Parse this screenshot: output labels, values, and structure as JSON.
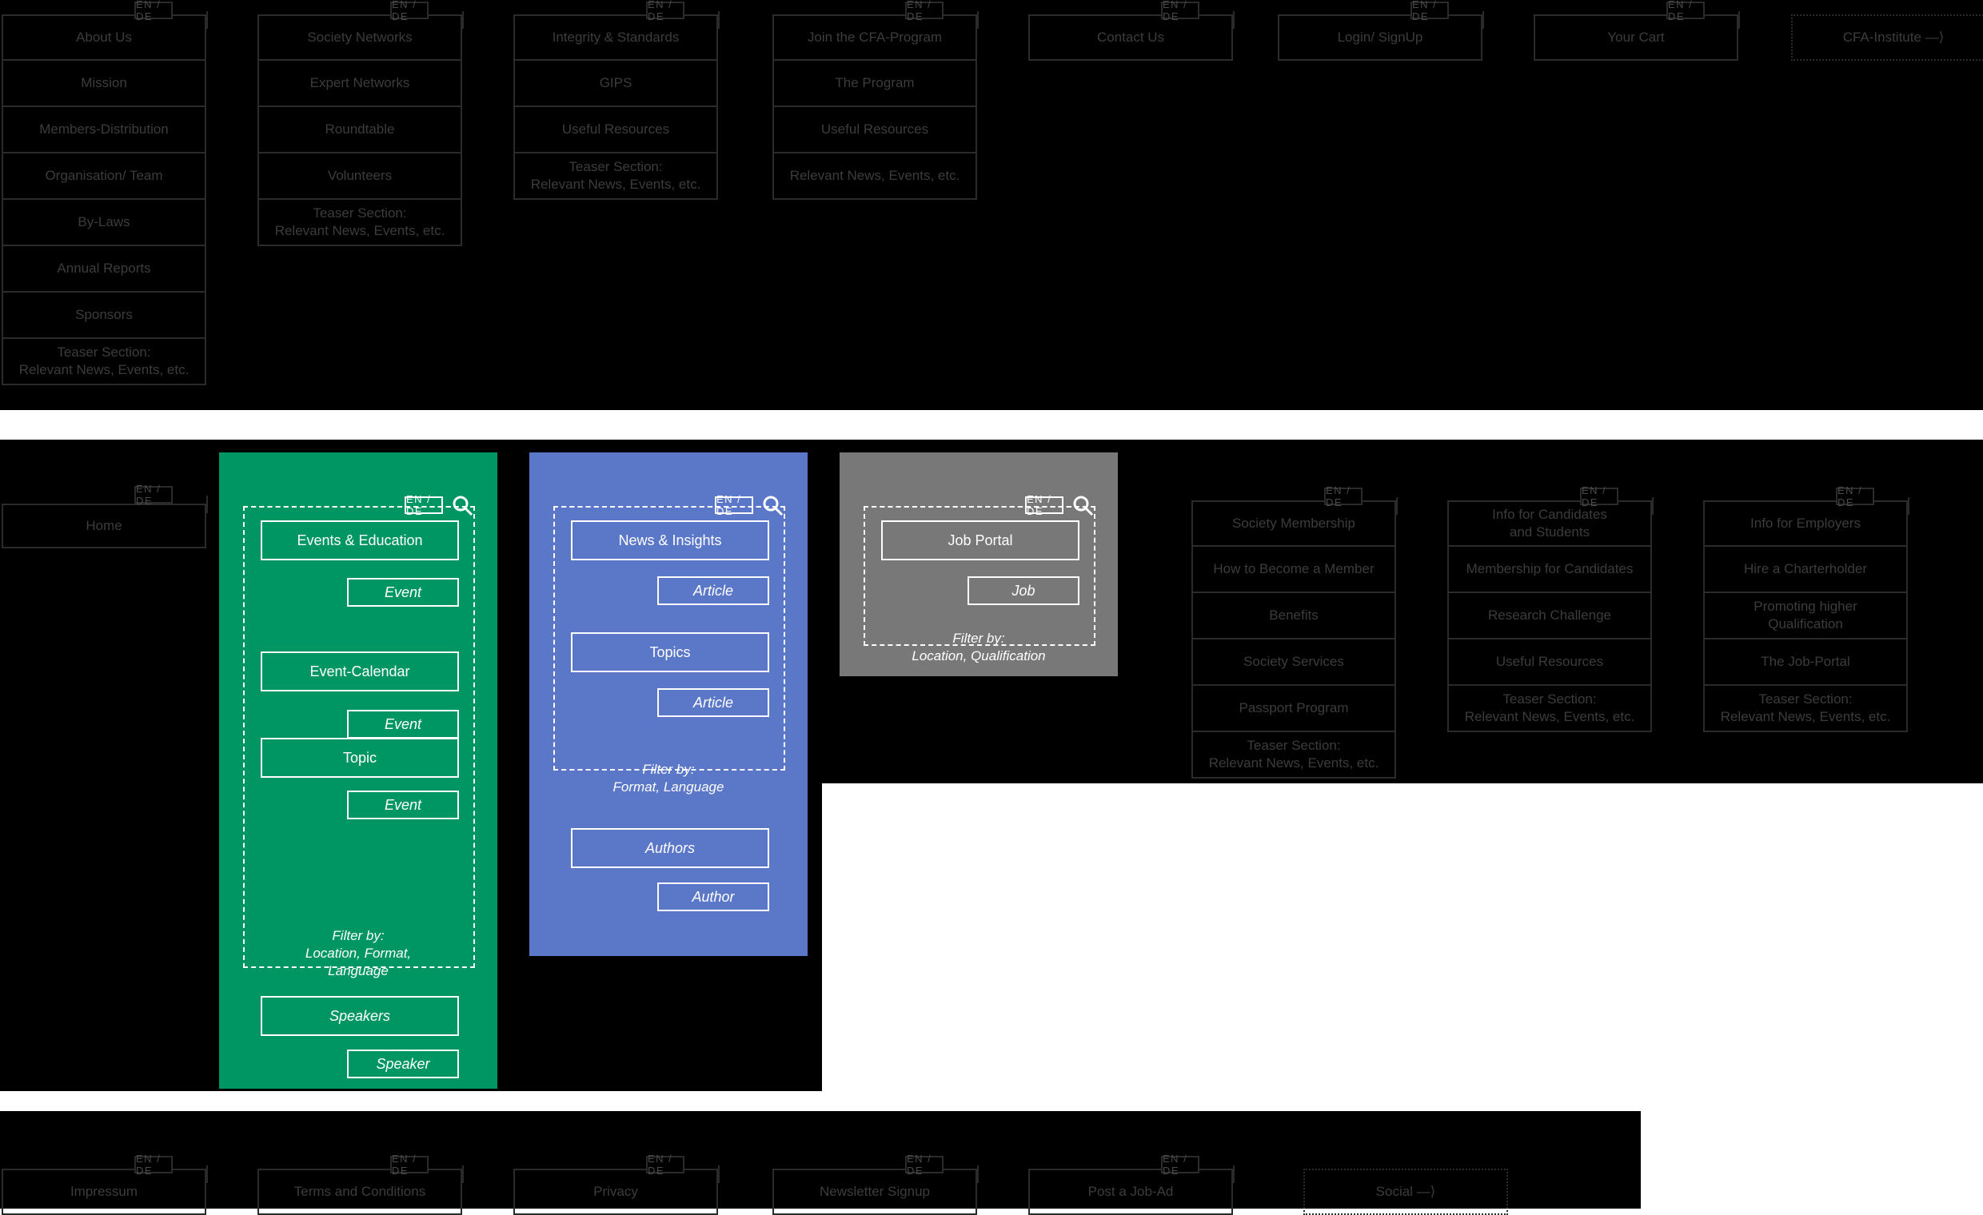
{
  "meta": {
    "lang_chip": "EN / DE",
    "colors": {
      "green": "#009663",
      "blue": "#5B77C8",
      "grey": "#787878",
      "panel_black": "#000000",
      "node_border": "#2b2b2b",
      "node_text": "#3c3c3c",
      "light_text": "#ffffff"
    },
    "teaser_line1": "Teaser Section:",
    "teaser_line2": "Relevant News, Events, etc."
  },
  "top_nav": {
    "columns": [
      {
        "header": "About Us",
        "items": [
          "Mission",
          "Members-Distribution",
          "Organisation/ Team",
          "By-Laws",
          "Annual Reports",
          "Sponsors",
          "Teaser Section:\nRelevant News, Events, etc."
        ]
      },
      {
        "header": "Society Networks",
        "items": [
          "Expert Networks",
          "Roundtable",
          "Volunteers",
          "Teaser Section:\nRelevant News, Events, etc."
        ]
      },
      {
        "header": "Integrity & Standards",
        "items": [
          "GIPS",
          "Useful Resources",
          "Teaser Section:\nRelevant News, Events, etc."
        ]
      },
      {
        "header": "Join the CFA-Program",
        "items": [
          "The Program",
          "Useful Resources",
          "Relevant News, Events, etc."
        ]
      }
    ],
    "standalone": [
      {
        "label": "Contact Us",
        "external": false
      },
      {
        "label": "Login/ SignUp",
        "external": false
      },
      {
        "label": "Your Cart",
        "external": false
      },
      {
        "label": "CFA-Institute —⟩",
        "external": true
      }
    ]
  },
  "home": {
    "label": "Home"
  },
  "sections": [
    {
      "key": "events",
      "color": "#009663",
      "title": "Events & Education",
      "nodes": [
        {
          "label": "Events & Education",
          "type": "primary"
        },
        {
          "label": "Event",
          "type": "leaf"
        },
        {
          "label": "Event-Calendar",
          "type": "primary"
        },
        {
          "label": "Event",
          "type": "leaf"
        },
        {
          "label": "Topic",
          "type": "primary"
        },
        {
          "label": "Event",
          "type": "leaf"
        }
      ],
      "filter": {
        "line1": "Filter by:",
        "line2": "Location, Format,",
        "line3": "Language"
      },
      "extra": [
        {
          "label": "Speakers",
          "type": "primary-italic"
        },
        {
          "label": "Speaker",
          "type": "leaf"
        }
      ]
    },
    {
      "key": "news",
      "color": "#5B77C8",
      "title": "News & Insights",
      "nodes": [
        {
          "label": "News & Insights",
          "type": "primary"
        },
        {
          "label": "Article",
          "type": "leaf"
        },
        {
          "label": "Topics",
          "type": "primary"
        },
        {
          "label": "Article",
          "type": "leaf"
        }
      ],
      "filter": {
        "line1": "Filter by:",
        "line2": "Format, Language",
        "line3": ""
      },
      "extra": [
        {
          "label": "Authors",
          "type": "primary-italic"
        },
        {
          "label": "Author",
          "type": "leaf"
        }
      ]
    },
    {
      "key": "jobs",
      "color": "#787878",
      "title": "Job Portal",
      "nodes": [
        {
          "label": "Job Portal",
          "type": "primary"
        },
        {
          "label": "Job",
          "type": "leaf"
        }
      ],
      "filter": {
        "line1": "Filter by:",
        "line2": "Location, Qualification",
        "line3": ""
      },
      "extra": []
    }
  ],
  "right_columns": [
    {
      "header": "Society Membership",
      "items": [
        "How to Become a Member",
        "Benefits",
        "Society Services",
        "Passport Program",
        "Teaser Section:\nRelevant News, Events, etc."
      ]
    },
    {
      "header": "Info for Candidates\nand Students",
      "items": [
        "Membership for Candidates",
        "Research Challenge",
        "Useful Resources",
        "Teaser Section:\nRelevant News, Events, etc."
      ]
    },
    {
      "header": "Info for Employers",
      "items": [
        "Hire a Charterholder",
        "Promoting higher\nQualification",
        "The Job-Portal",
        "Teaser Section:\nRelevant News, Events, etc."
      ]
    }
  ],
  "footer": {
    "items": [
      {
        "label": "Impressum",
        "external": false
      },
      {
        "label": "Terms and Conditions",
        "external": false
      },
      {
        "label": "Privacy",
        "external": false
      },
      {
        "label": "Newsletter Signup",
        "external": false
      },
      {
        "label": "Post a Job-Ad",
        "external": false
      },
      {
        "label": "Social  —⟩",
        "external": true
      }
    ]
  }
}
